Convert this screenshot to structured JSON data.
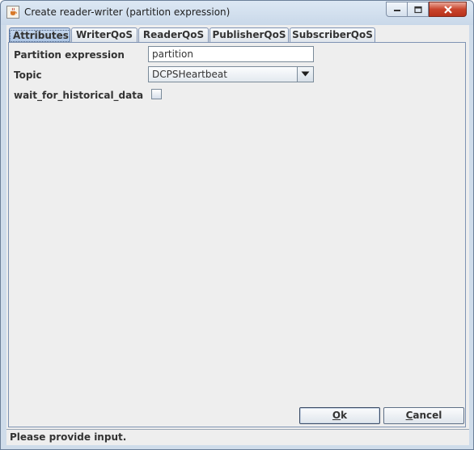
{
  "window": {
    "title": "Create reader-writer (partition expression)"
  },
  "tabs": [
    {
      "label": "Attributes",
      "selected": true
    },
    {
      "label": "WriterQoS",
      "selected": false
    },
    {
      "label": "ReaderQoS",
      "selected": false
    },
    {
      "label": "PublisherQoS",
      "selected": false
    },
    {
      "label": "SubscriberQoS",
      "selected": false
    }
  ],
  "form": {
    "partition_label": "Partition expression",
    "partition_value": "partition",
    "topic_label": "Topic",
    "topic_value": "DCPSHeartbeat",
    "historical_label": "wait_for_historical_data",
    "historical_checked": false
  },
  "buttons": {
    "ok_mnemonic": "O",
    "ok_rest": "k",
    "cancel_mnemonic": "C",
    "cancel_rest": "ancel"
  },
  "status": {
    "text": "Please provide input."
  },
  "icons": {
    "title": "java-cup-icon",
    "minimize": "minimize-icon",
    "maximize": "maximize-icon",
    "close": "close-icon",
    "combo": "chevron-down-icon"
  },
  "colors": {
    "close_button": "#c9442c",
    "selected_tab": "#a9c2e2"
  }
}
